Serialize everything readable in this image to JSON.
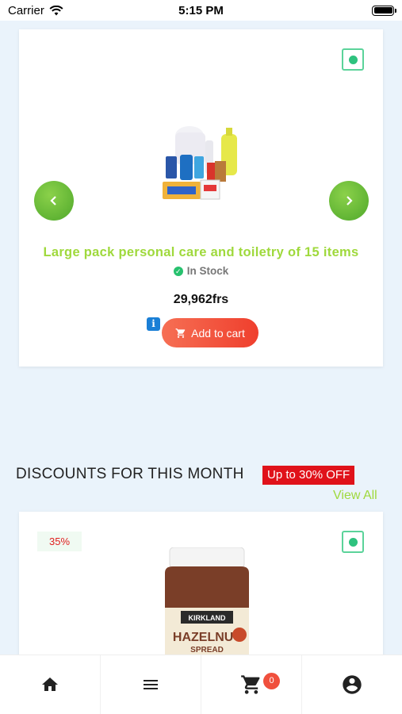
{
  "status_bar": {
    "carrier": "Carrier",
    "time": "5:15 PM"
  },
  "featured": {
    "title": "Large pack personal care and toiletry of 15 items",
    "stock": "In Stock",
    "price": "29,962frs",
    "add_to_cart": "Add to cart",
    "info": "i"
  },
  "discounts": {
    "section_title": "DISCOUNTS FOR THIS MONTH",
    "badge": "Up to 30% OFF",
    "view_all": "View All",
    "item": {
      "discount_tag": "35%",
      "jar_brand": "KIRKLAND",
      "jar_line1": "HAZELNUT",
      "jar_line2": "SPREAD"
    }
  },
  "bottom_nav": {
    "cart_count": "0"
  },
  "colors": {
    "accent_green": "#9fd93c",
    "cart_button": "#ef3f2d",
    "badge_red": "#e0121a",
    "select_green": "#2ec27e"
  },
  "icons": [
    "wifi-icon",
    "battery-icon",
    "chevron-left-icon",
    "chevron-right-icon",
    "check-circle-icon",
    "info-icon",
    "cart-icon",
    "home-icon",
    "menu-icon",
    "user-icon"
  ]
}
